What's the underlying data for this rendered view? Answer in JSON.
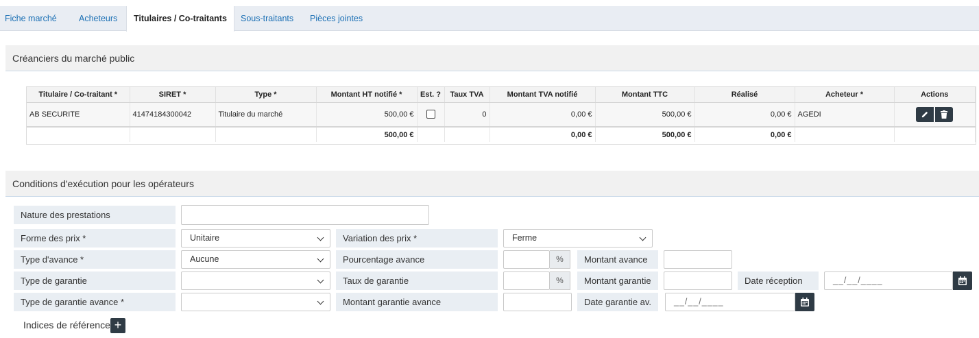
{
  "tabs": [
    {
      "label": "Fiche marché"
    },
    {
      "label": "Acheteurs"
    },
    {
      "label": "Titulaires / Co-traitants"
    },
    {
      "label": "Sous-traitants"
    },
    {
      "label": "Pièces jointes"
    }
  ],
  "creanciers": {
    "title": "Créanciers du marché public",
    "columns": [
      "Titulaire / Co-traitant *",
      "SIRET *",
      "Type *",
      "Montant HT notifié *",
      "Est. ?",
      "Taux TVA",
      "Montant TVA notifié",
      "Montant TTC",
      "Réalisé",
      "Acheteur *",
      "Actions"
    ],
    "rows": [
      {
        "titulaire": "AB SECURITE",
        "siret": "41474184300042",
        "type": "Titulaire du marché",
        "montant_ht": "500,00 €",
        "taux_tva": "0",
        "montant_tva": "0,00 €",
        "montant_ttc": "500,00 €",
        "realise": "0,00 €",
        "acheteur": "AGEDI"
      }
    ],
    "totals": {
      "montant_ht": "500,00 €",
      "montant_tva": "0,00 €",
      "montant_ttc": "500,00 €",
      "realise": "0,00 €"
    }
  },
  "conditions": {
    "title": "Conditions d'exécution pour les opérateurs",
    "nature_label": "Nature des prestations",
    "nature_value": "",
    "forme_label": "Forme des prix *",
    "forme_value": "Unitaire",
    "variation_label": "Variation des prix *",
    "variation_value": "Ferme",
    "avance_type_label": "Type d'avance *",
    "avance_type_value": "Aucune",
    "pourcentage_label": "Pourcentage avance",
    "pourcentage_unit": "%",
    "montant_avance_label": "Montant avance",
    "garantie_type_label": "Type de garantie",
    "taux_garantie_label": "Taux de garantie",
    "taux_garantie_unit": "%",
    "montant_garantie_label": "Montant garantie",
    "date_reception_label": "Date réception",
    "date_placeholder": "__/__/____",
    "garantie_avance_type_label": "Type de garantie avance *",
    "montant_garantie_avance_label": "Montant garantie avance",
    "date_garantie_label": "Date garantie av.",
    "indices_label": "Indices de référence",
    "plus_symbol": "+"
  }
}
